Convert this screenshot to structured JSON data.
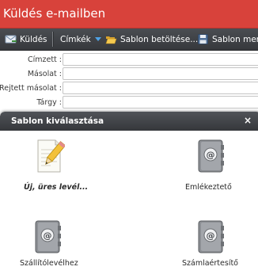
{
  "window": {
    "title": "Küldés e-mailben"
  },
  "toolbar": {
    "send_label": "Küldés",
    "tags_label": "Címkék",
    "load_template_label": "Sablon betöltése...",
    "save_template_label": "Sablon mentése"
  },
  "form": {
    "to_label": "Címzett :",
    "cc_label": "Másolat :",
    "bcc_label": "Rejtett másolat :",
    "subject_label": "Tárgy :",
    "to_value": "",
    "cc_value": "",
    "bcc_value": "",
    "subject_value": ""
  },
  "modal": {
    "title": "Sablon kiválasztása",
    "close_label": "×",
    "templates": [
      {
        "label": "Új, üres levél...",
        "icon": "new-letter-icon"
      },
      {
        "label": "Emlékeztető",
        "icon": "address-book-icon"
      },
      {
        "label": "Szállítólevélhez",
        "icon": "address-book-icon"
      },
      {
        "label": "Számlaértesítő",
        "icon": "address-book-icon"
      }
    ]
  },
  "colors": {
    "titlebar": "#d8423b",
    "toolbar": "#3f4246",
    "modal_header": "#424448",
    "caret": "#4fa3e6"
  }
}
